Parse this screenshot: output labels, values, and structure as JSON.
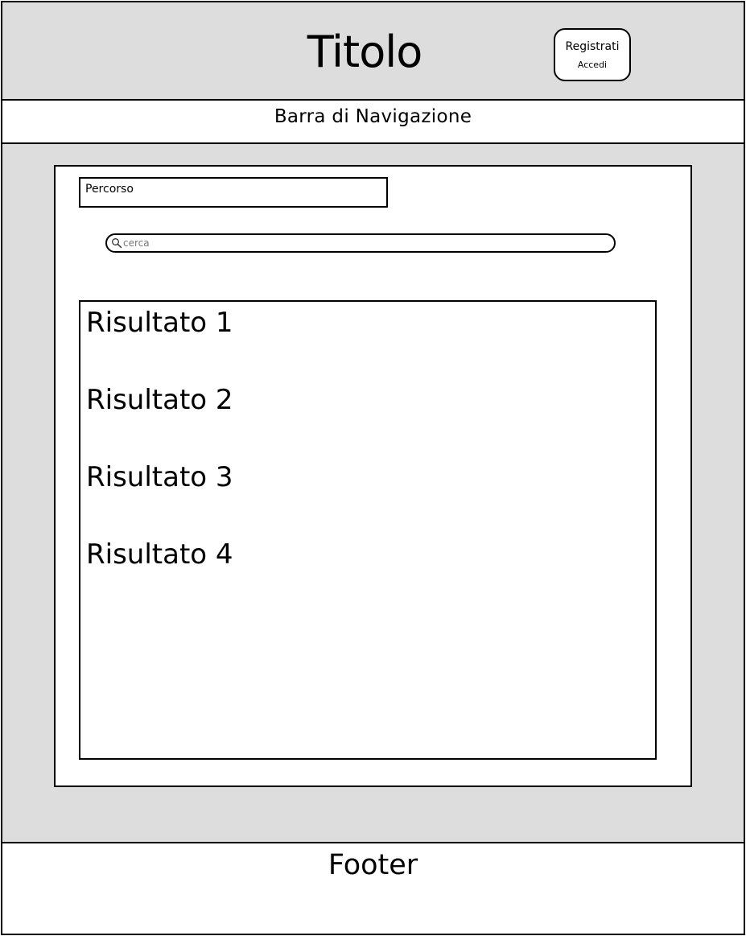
{
  "header": {
    "title": "Titolo",
    "register_label": "Registrati",
    "login_label": "Accedi"
  },
  "navbar": {
    "label": "Barra di Navigazione"
  },
  "breadcrumb": {
    "label": "Percorso"
  },
  "search": {
    "placeholder": "cerca",
    "value": "",
    "icon": "search-icon"
  },
  "results": [
    {
      "label": "Risultato 1"
    },
    {
      "label": "Risultato 2"
    },
    {
      "label": "Risultato 3"
    },
    {
      "label": "Risultato 4"
    }
  ],
  "footer": {
    "label": "Footer"
  },
  "colors": {
    "background_gray": "#dddddd",
    "panel_white": "#ffffff",
    "border": "#000000"
  }
}
